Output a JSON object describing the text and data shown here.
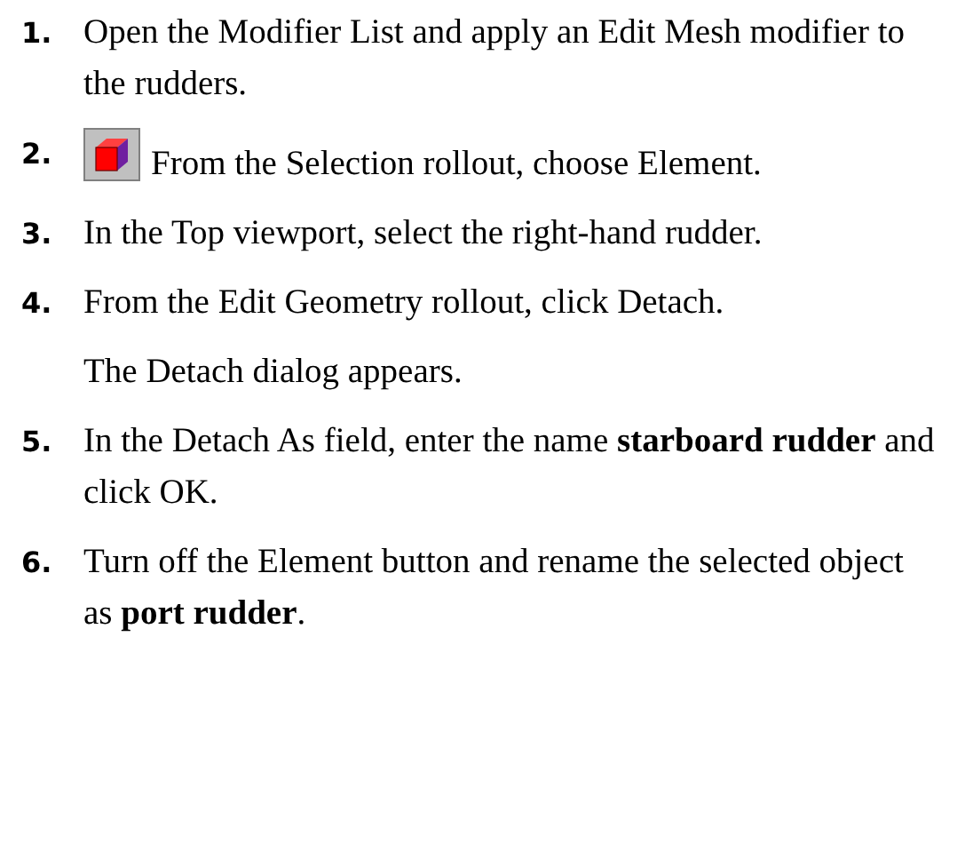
{
  "steps": [
    {
      "kind": "text",
      "number": "1.",
      "text": "Open the Modifier List and apply an Edit Mesh modifier to the rudders."
    },
    {
      "kind": "icon",
      "number": "2.",
      "text": "From the Selection rollout, choose Element."
    },
    {
      "kind": "text",
      "number": "3.",
      "text": "In the Top viewport, select the right-hand rudder."
    },
    {
      "kind": "text",
      "number": "4.",
      "text": "From the Edit Geometry rollout, click Detach.",
      "note": "The Detach dialog appears."
    },
    {
      "kind": "text",
      "number": "5.",
      "text": "In the Detach As field, enter the name **starboard rudder** and click OK."
    },
    {
      "kind": "text",
      "number": "6.",
      "text": "Turn off the Element button and rename the selected object as **port rudder**."
    }
  ]
}
